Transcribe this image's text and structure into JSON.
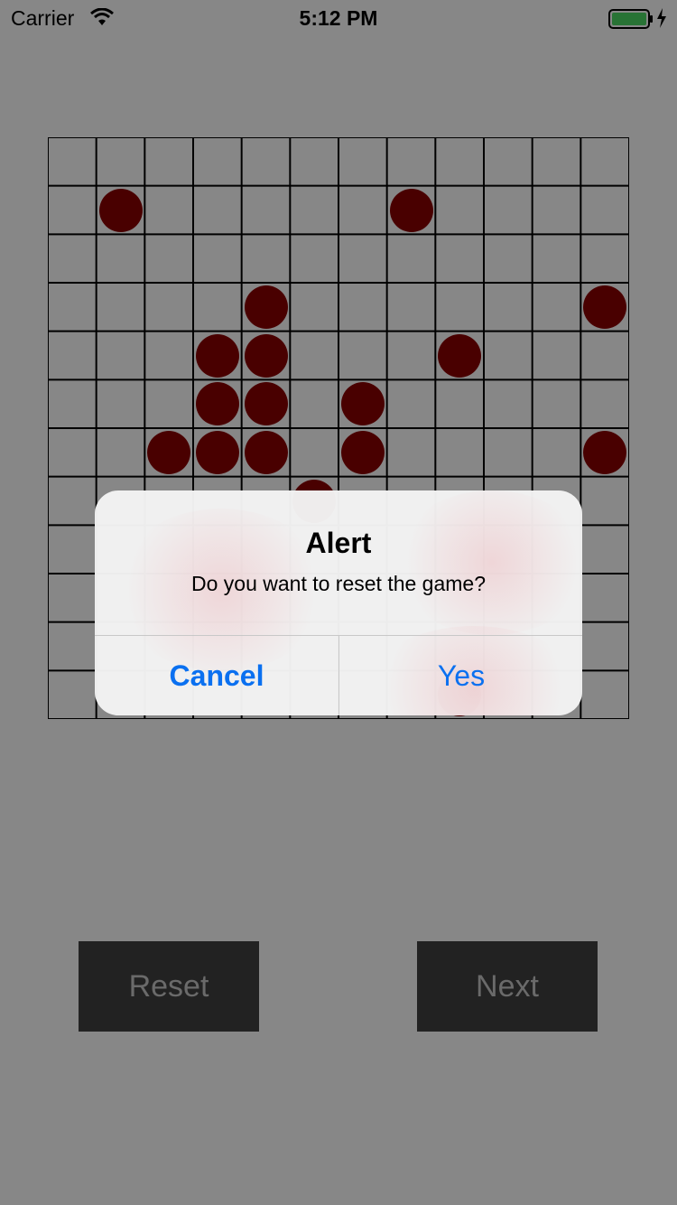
{
  "status_bar": {
    "carrier": "Carrier",
    "time": "5:12 PM",
    "icons": [
      "wifi-icon",
      "battery-icon",
      "charging-icon"
    ]
  },
  "board": {
    "rows": 12,
    "cols": 12,
    "stone_color": "#8b0000",
    "stones": [
      [
        1,
        1
      ],
      [
        1,
        7
      ],
      [
        3,
        4
      ],
      [
        3,
        11
      ],
      [
        4,
        3
      ],
      [
        4,
        4
      ],
      [
        4,
        8
      ],
      [
        5,
        3
      ],
      [
        5,
        4
      ],
      [
        5,
        6
      ],
      [
        6,
        2
      ],
      [
        6,
        3
      ],
      [
        6,
        4
      ],
      [
        6,
        6
      ],
      [
        6,
        11
      ],
      [
        7,
        5
      ],
      [
        11,
        8
      ]
    ]
  },
  "controls": {
    "reset_label": "Reset",
    "next_label": "Next"
  },
  "alert": {
    "title": "Alert",
    "message": "Do you want to reset the game?",
    "cancel_label": "Cancel",
    "yes_label": "Yes",
    "accent": "#0a70f0"
  }
}
